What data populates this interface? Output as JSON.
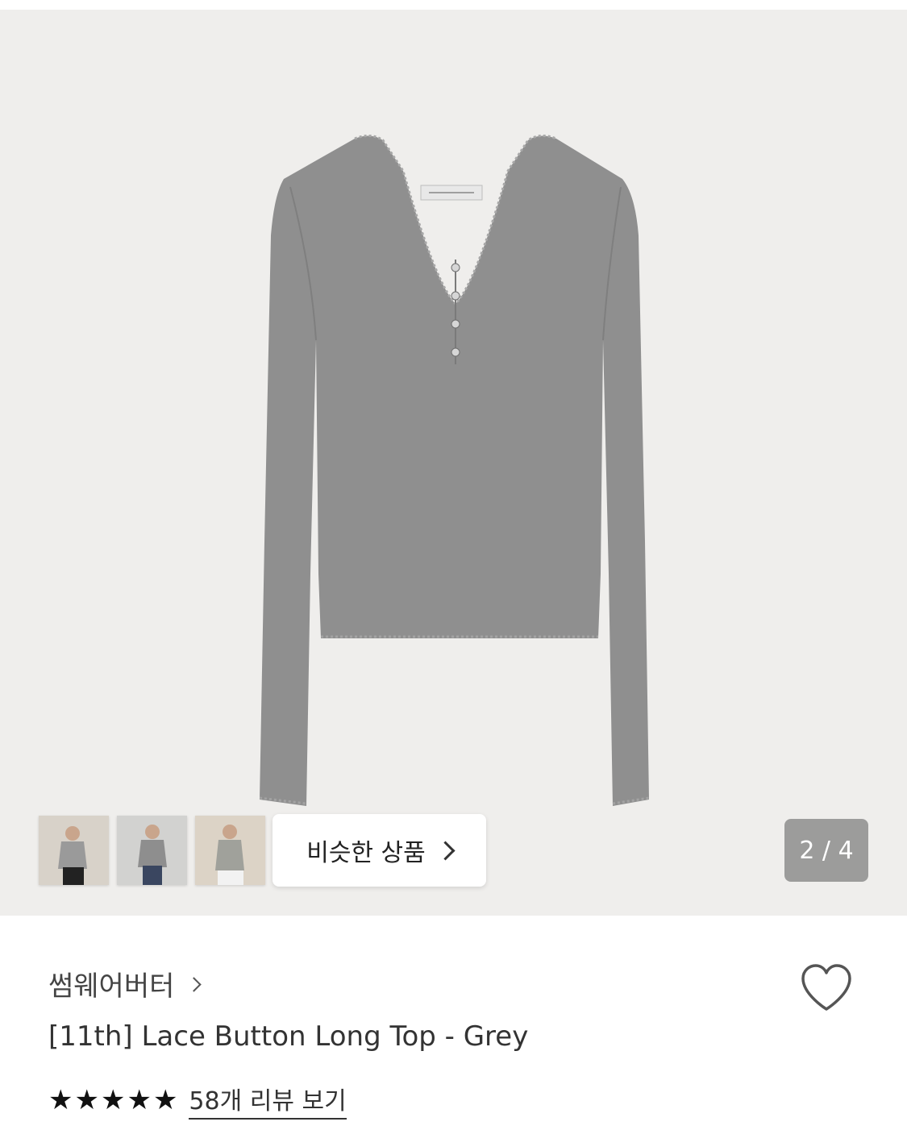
{
  "gallery": {
    "similar_label": "비슷한 상품",
    "page_indicator": "2 / 4",
    "current_page": 2,
    "total_pages": 4
  },
  "product": {
    "brand": "썸웨어버터",
    "name": "[11th] Lace Button Long Top - Grey",
    "rating": 5,
    "review_link": "58개 리뷰 보기",
    "stars": [
      "★",
      "★",
      "★",
      "★",
      "★"
    ]
  },
  "colors": {
    "gallery_bg": "#efeeec",
    "garment": "#8f8f8f",
    "indicator_bg": "#8a8a8a"
  },
  "icons": {
    "wishlist": "heart-outline-icon",
    "chevron": "chevron-right-icon",
    "star": "star-filled-icon"
  }
}
